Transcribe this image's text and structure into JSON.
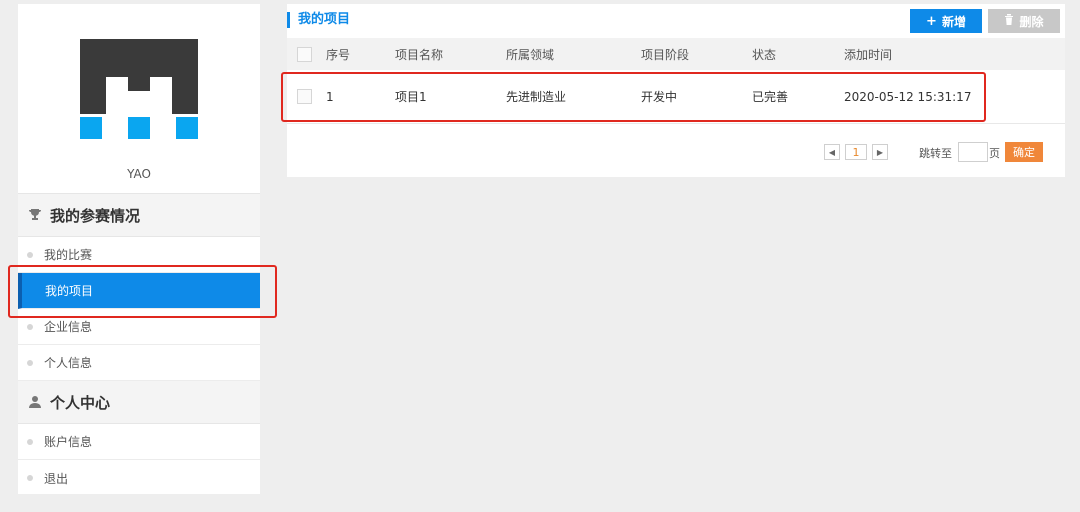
{
  "profile": {
    "username": "YAO"
  },
  "sidebar": {
    "sections": [
      {
        "title": "我的参赛情况",
        "icon": "trophy-icon",
        "items": [
          {
            "label": "我的比赛"
          },
          {
            "label": "我的项目",
            "active": true
          },
          {
            "label": "企业信息"
          },
          {
            "label": "个人信息"
          }
        ]
      },
      {
        "title": "个人中心",
        "icon": "user-icon",
        "items": [
          {
            "label": "账户信息"
          },
          {
            "label": "退出"
          }
        ]
      }
    ]
  },
  "main": {
    "title": "我的项目",
    "add_label": "新增",
    "delete_label": "删除",
    "columns": [
      "序号",
      "项目名称",
      "所属领域",
      "项目阶段",
      "状态",
      "添加时间"
    ],
    "rows": [
      {
        "no": "1",
        "name": "项目1",
        "field": "先进制造业",
        "stage": "开发中",
        "status": "已完善",
        "time": "2020-05-12 15:31:17"
      }
    ],
    "pagination": {
      "current_page": "1",
      "jump_label": "跳转至",
      "page_label": "页",
      "confirm_label": "确定"
    }
  },
  "colors": {
    "accent": "#0e8ae8",
    "logo_dark": "#3a3a3a",
    "logo_blue": "#0aa6f0",
    "confirm": "#f0873a",
    "highlight": "#e0281f"
  }
}
